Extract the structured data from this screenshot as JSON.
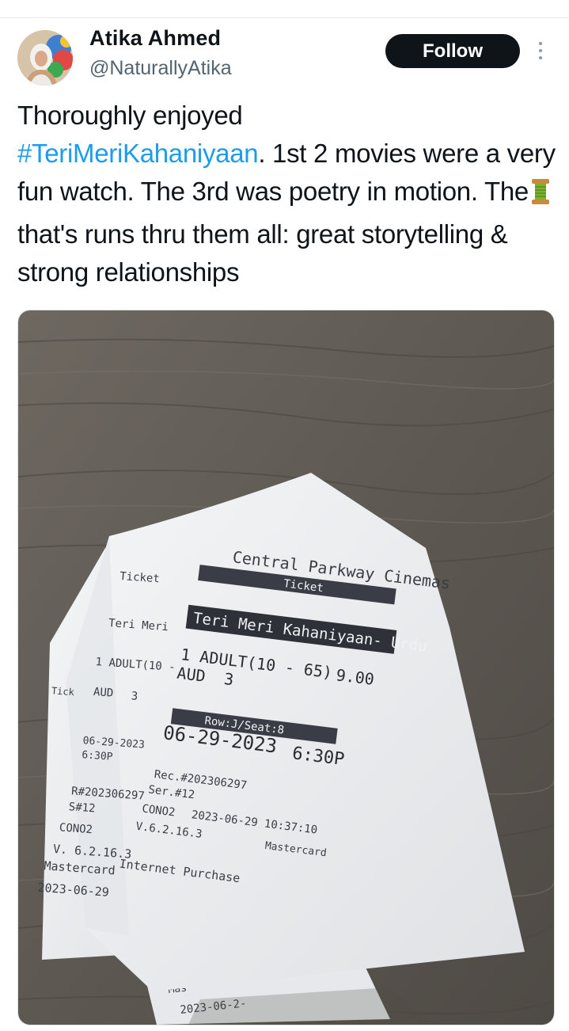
{
  "author": {
    "name": "Atika Ahmed",
    "handle": "@NaturallyAtika"
  },
  "actions": {
    "follow_label": "Follow"
  },
  "tweet": {
    "text_before_hashtag": "Thoroughly enjoyed",
    "hashtag": "#TeriMeriKahaniyaan",
    "text_after_hashtag": ". 1st 2 movies were a very fun watch. The 3rd was poetry in motion. The",
    "emoji": "spool-of-thread",
    "text_after_emoji": " that's runs thru them all: great storytelling & strong relationships"
  },
  "media": {
    "description_icon": "receipt-photo",
    "receipt_front": {
      "cinema": "Central Parkway Cinemas",
      "type": "Ticket",
      "movie": "Teri Meri Kahaniyaan- Urdu",
      "line": "1 ADULT(10 - 65)",
      "price": "9.00",
      "aud": "AUD",
      "aud_no": "3",
      "seat": "Row:J/Seat:8",
      "date": "06-29-2023",
      "time": "6:30P",
      "rec": "Rec.#202306297",
      "ser": "Ser.#12",
      "con": "CONO2",
      "timestamp": "2023-06-29 10:37:10",
      "version": "V.6.2.16.3",
      "card": "Mastercard",
      "purchase": "Internet Purchase"
    },
    "receipt_stub": {
      "ticket_label": "Ticket",
      "title_short": "Teri Meri",
      "line_short": "1 ADULT(10 -",
      "aud": "AUD",
      "aud_no": "3",
      "tick": "Tick",
      "date": "06-29-2023",
      "time": "6:30P",
      "rec": "R#202306297",
      "ser": "S#12",
      "con": "CONO2",
      "version": "V. 6.2.16.3",
      "card": "Mastercard",
      "date2": "2023-06-29"
    },
    "receipt_bottom": {
      "card_short": "Mas",
      "date_short": "2023-06-2-"
    }
  }
}
